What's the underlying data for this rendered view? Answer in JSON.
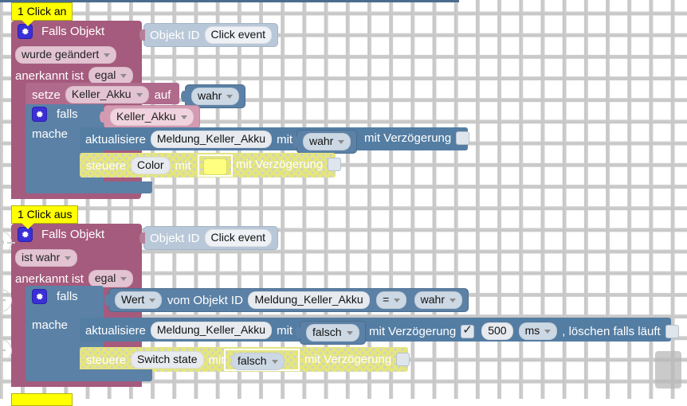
{
  "app": {
    "title": "Blockly Script Editor",
    "background": "#ffffff",
    "grid_color": "#c4c4c4"
  },
  "colors": {
    "event_block": "#a55b7d",
    "event_block_light": "#b06a8c",
    "action_block": "#5b81a6",
    "value_field_pink": "#e3c3d2",
    "value_field_blue": "#ccd8e4",
    "comment_yellow": "#ffff00",
    "disabled_hatch": "#e6e678",
    "color_swatch": "#ffff80",
    "mutator_icon": "#3b2fd6"
  },
  "scripts": [
    {
      "comment": "1 Click an",
      "event": {
        "mutator_icon": "gear-icon",
        "title": "Falls Objekt",
        "object_id_block": {
          "label": "Objekt ID",
          "value": "Click event"
        },
        "condition_dropdown": "wurde geändert",
        "ack_label": "anerkannt ist",
        "ack_dropdown": "egal"
      },
      "statements": [
        {
          "type": "set",
          "label": "setze",
          "target": "Keller_Akku",
          "mid_label": "auf",
          "value_dropdown": "wahr"
        },
        {
          "type": "if",
          "mutator_icon": "gear-icon",
          "label": "falls",
          "condition": "Keller_Akku",
          "do_label": "mache",
          "body": [
            {
              "type": "update",
              "disabled": false,
              "label": "aktualisiere",
              "target": "Meldung_Keller_Akku",
              "mid_label": "mit",
              "value_dropdown": "wahr",
              "delay_label": "mit Verzögerung",
              "delay_checked": false
            },
            {
              "type": "control",
              "disabled": true,
              "selected": true,
              "label": "steuere",
              "target": "Color",
              "mid_label": "mit",
              "value_color": "#ffff80",
              "delay_label": "mit Verzögerung",
              "delay_checked": false
            }
          ]
        }
      ]
    },
    {
      "comment": "1 Click aus",
      "event": {
        "mutator_icon": "gear-icon",
        "title": "Falls Objekt",
        "object_id_block": {
          "label": "Objekt ID",
          "value": "Click event"
        },
        "condition_dropdown": "ist wahr",
        "ack_label": "anerkannt ist",
        "ack_dropdown": "egal"
      },
      "statements": [
        {
          "type": "if",
          "mutator_icon": "gear-icon",
          "label": "falls",
          "do_label": "mache",
          "condition_expr": {
            "left_dropdown": "Wert",
            "mid_label": "vom Objekt ID",
            "object_id": "Meldung_Keller_Akku",
            "operator": "=",
            "right_dropdown": "wahr"
          },
          "body": [
            {
              "type": "update",
              "disabled": false,
              "label": "aktualisiere",
              "target": "Meldung_Keller_Akku",
              "mid_label": "mit",
              "value_dropdown": "falsch",
              "delay_label": "mit Verzögerung",
              "delay_checked": true,
              "delay_value": "500",
              "delay_unit": "ms",
              "clear_label": ", löschen falls läuft",
              "clear_checked": false
            },
            {
              "type": "control",
              "disabled": true,
              "selected": true,
              "label": "steuere",
              "target": "Switch state",
              "mid_label": "mit",
              "value_dropdown": "falsch",
              "delay_label": "mit Verzögerung",
              "delay_checked": false
            }
          ]
        }
      ]
    },
    {
      "comment": ""
    }
  ],
  "zoom_controls": [
    {
      "name": "center-on-blocks",
      "icon": "crosshair-icon"
    },
    {
      "name": "zoom-in",
      "icon": "plus-icon"
    },
    {
      "name": "zoom-out",
      "icon": "minus-icon"
    }
  ]
}
